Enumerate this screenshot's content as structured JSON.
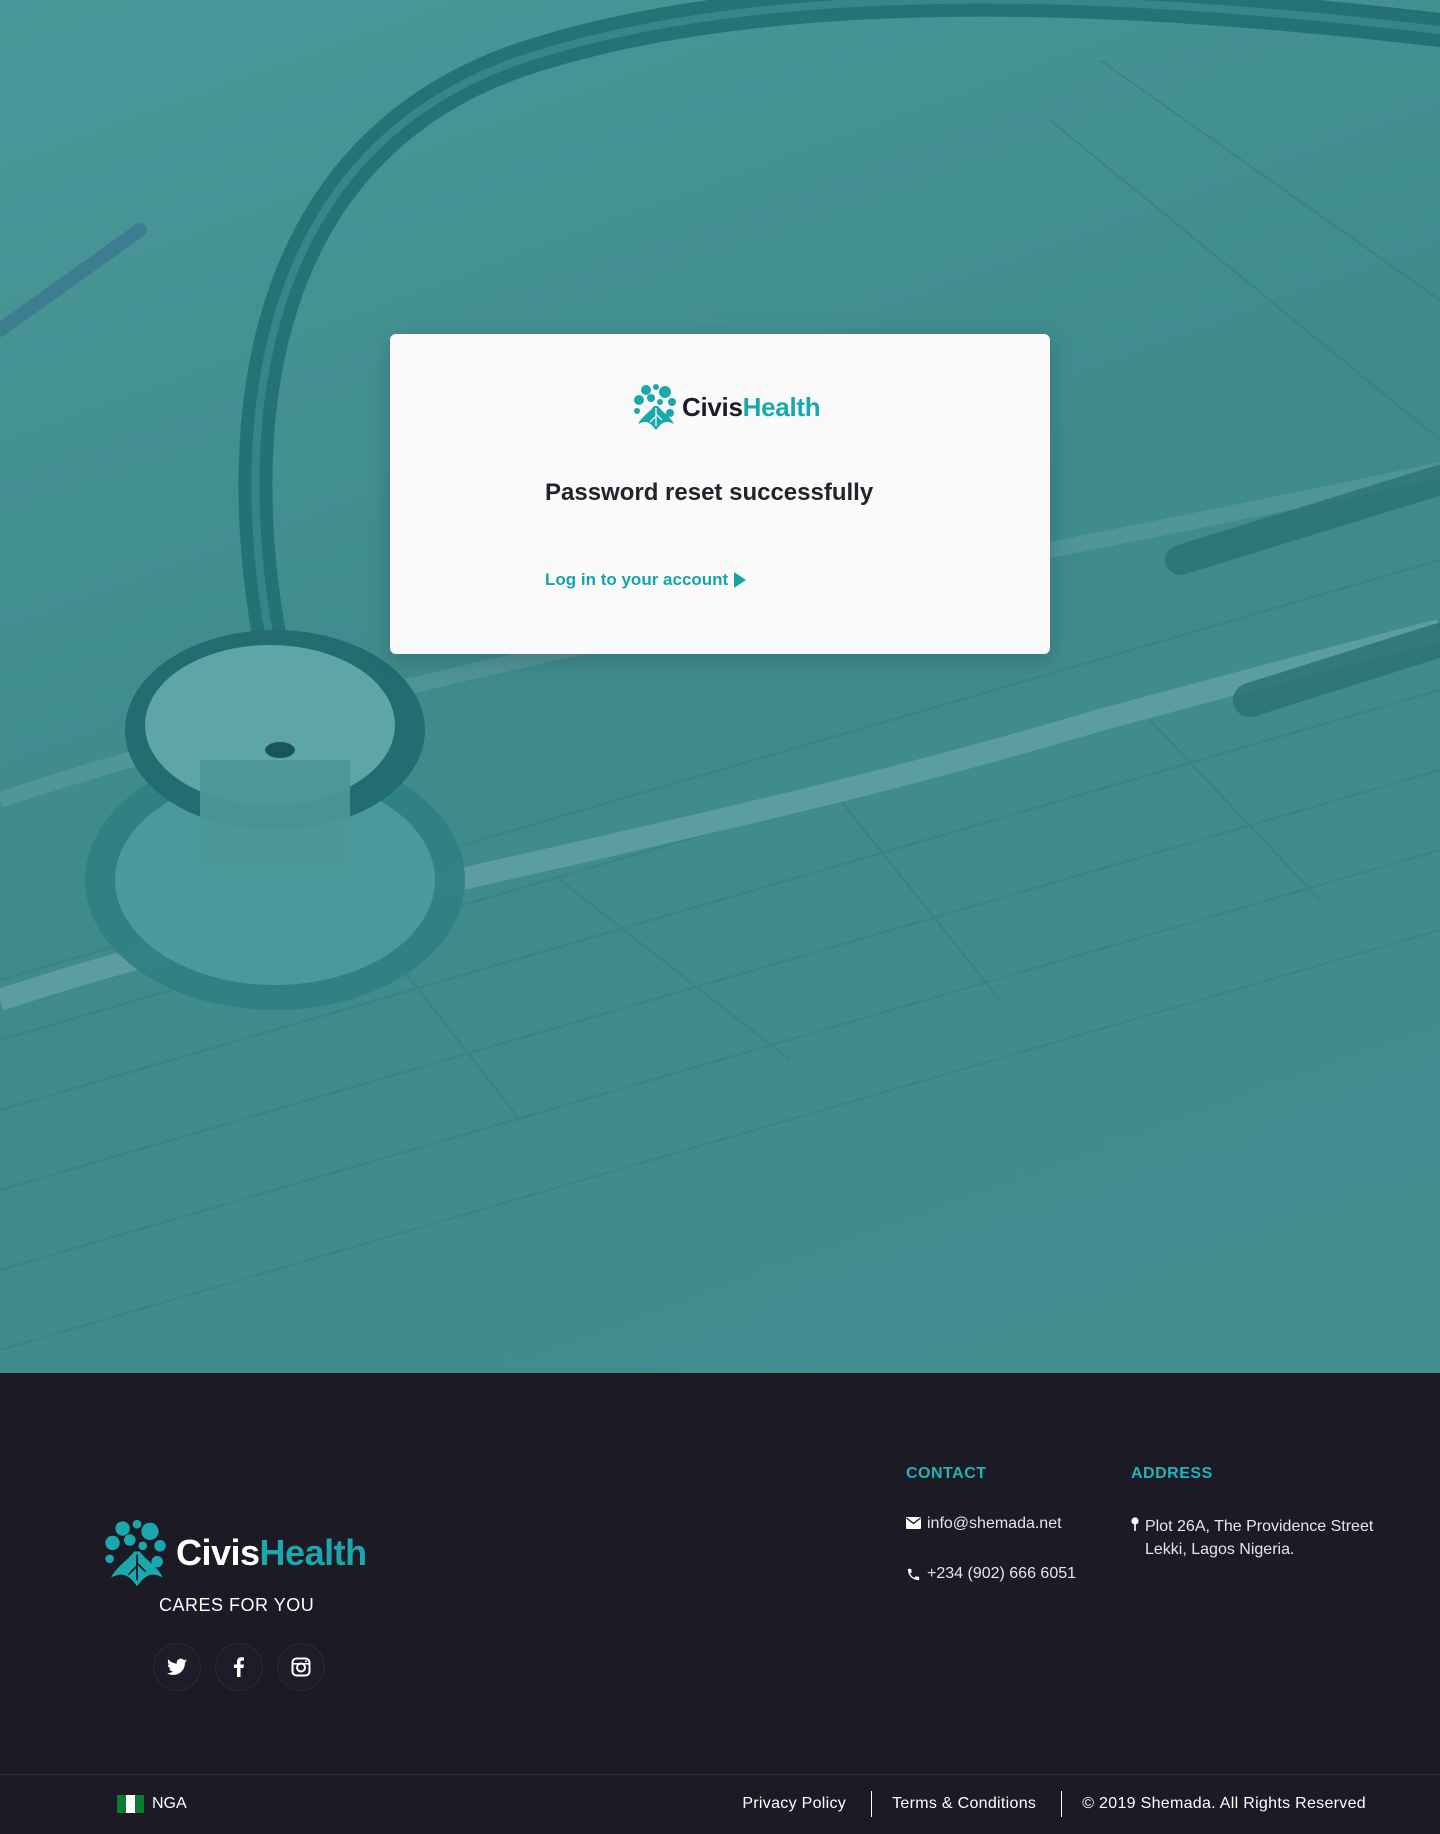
{
  "brand": {
    "name_part1": "Civis",
    "name_part2": "Health",
    "accent_color": "#1ba8ac",
    "hero_overlay_color": "#3f8b8c",
    "footer_bg_color": "#1c1a25"
  },
  "card": {
    "title": "Password reset successfully",
    "login_link_label": "Log in to your account"
  },
  "footer": {
    "tagline": "CARES FOR YOU",
    "socials": [
      {
        "icon": "twitter-icon"
      },
      {
        "icon": "facebook-icon"
      },
      {
        "icon": "instagram-icon"
      }
    ],
    "contact": {
      "heading": "CONTACT",
      "email": "info@shemada.net",
      "phone": "+234 (902) 666 6051"
    },
    "address": {
      "heading": "ADDRESS",
      "line1": "Plot 26A, The Providence Street",
      "line2": "Lekki, Lagos Nigeria."
    }
  },
  "bottom_bar": {
    "country_code": "NGA",
    "privacy_label": "Privacy Policy",
    "terms_label": "Terms & Conditions",
    "copyright": "© 2019 Shemada. All Rights Reserved"
  }
}
